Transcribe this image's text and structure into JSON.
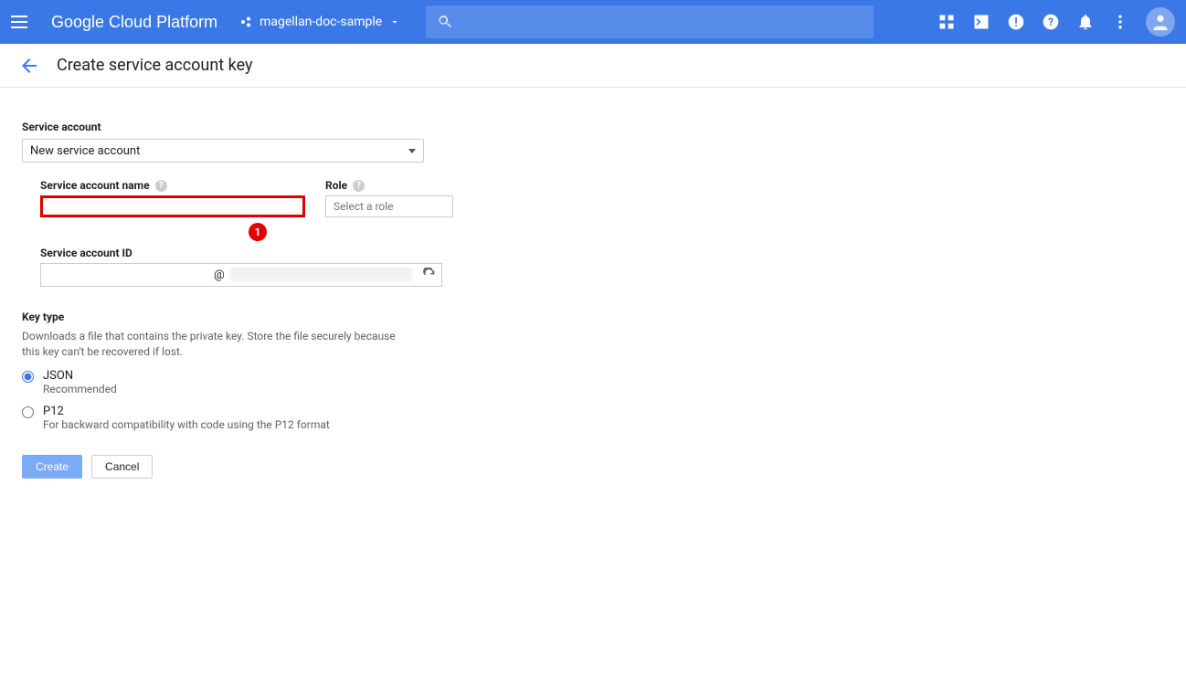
{
  "header": {
    "brand": "Google Cloud Platform",
    "project": "magellan-doc-sample"
  },
  "page": {
    "title": "Create service account key"
  },
  "form": {
    "service_account_label": "Service account",
    "service_account_value": "New service account",
    "name_label": "Service account name",
    "name_value": "",
    "role_label": "Role",
    "role_placeholder": "Select a role",
    "id_label": "Service account ID",
    "id_value": "",
    "id_at": "@",
    "callout_number": "1"
  },
  "keytype": {
    "label": "Key type",
    "description": "Downloads a file that contains the private key. Store the file securely because this key can't be recovered if lost.",
    "options": [
      {
        "title": "JSON",
        "desc": "Recommended",
        "checked": true
      },
      {
        "title": "P12",
        "desc": "For backward compatibility with code using the P12 format",
        "checked": false
      }
    ]
  },
  "buttons": {
    "create": "Create",
    "cancel": "Cancel"
  }
}
